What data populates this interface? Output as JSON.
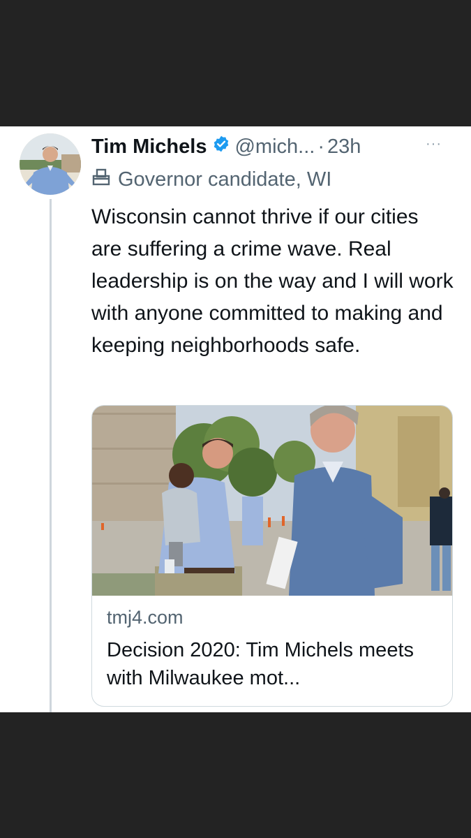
{
  "tweet": {
    "author_name": "Tim Michels",
    "handle": "@mich...",
    "separator": "·",
    "time": "23h",
    "more_label": "···",
    "label_text": "Governor candidate, WI",
    "text": "Wisconsin cannot thrive if our cities are suffering a crime wave. Real leadership is on the way and I will work with anyone committed to making and keeping neighborhoods safe."
  },
  "link_card": {
    "domain": "tmj4.com",
    "title": "Decision 2020: Tim Michels meets with Milwaukee mot..."
  },
  "icons": {
    "verified": "verified-badge-icon",
    "label": "ballot-box-icon",
    "more": "more-dots-icon"
  },
  "colors": {
    "background_bar": "#232323",
    "card": "#ffffff",
    "primary_text": "#0f1419",
    "secondary_text": "#536471",
    "verified_blue": "#1d9bf0",
    "thread_line": "#cfd6dc"
  }
}
